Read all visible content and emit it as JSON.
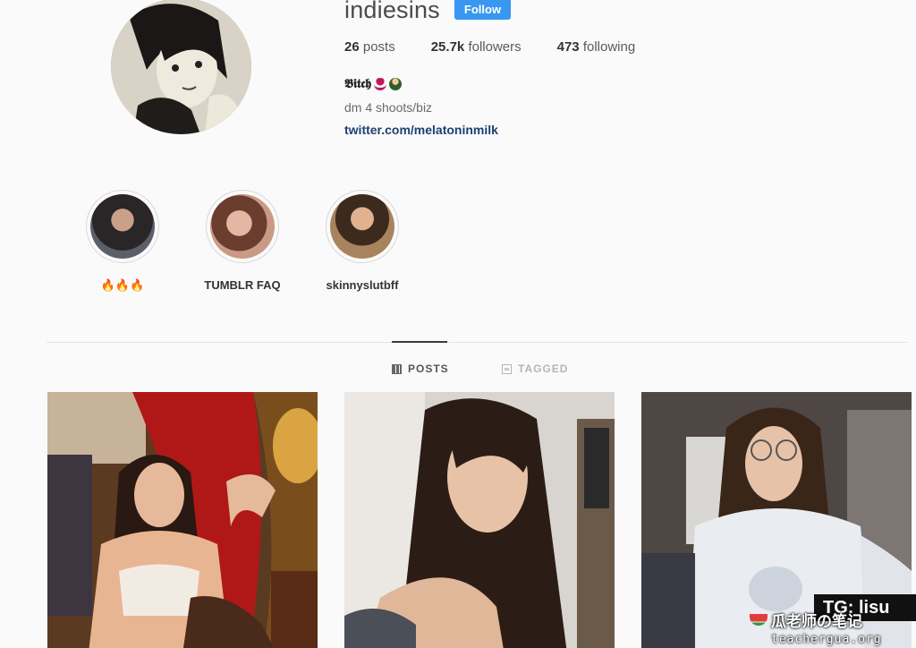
{
  "profile": {
    "username": "indiesins",
    "follow_label": "Follow",
    "stats": {
      "posts_count": "26",
      "posts_label": "posts",
      "followers_count": "25.7k",
      "followers_label": "followers",
      "following_count": "473",
      "following_label": "following"
    },
    "bio_name": "𝕭𝖎𝖙𝖈𝖍",
    "bio_emojis": [
      "wine-glass-emoji",
      "woman-emoji"
    ],
    "bio_line": "dm 4 shoots/biz",
    "bio_link": "twitter.com/melatoninmilk"
  },
  "highlights": [
    {
      "label": "🔥🔥🔥",
      "color": "#2e2a2c"
    },
    {
      "label": "TUMBLR FAQ",
      "color": "#b88a78"
    },
    {
      "label": "skinnyslutbff",
      "color": "#8a6a4e"
    }
  ],
  "tabs": [
    {
      "label": "POSTS",
      "icon": "grid-icon",
      "active": true
    },
    {
      "label": "TAGGED",
      "icon": "tag-icon",
      "active": false
    }
  ],
  "posts": [
    {
      "subject": "portrait-red-curtain",
      "dominant_color": "#a91c1c"
    },
    {
      "subject": "selfie-long-hair",
      "dominant_color": "#c9c2b8"
    },
    {
      "subject": "selfie-glasses",
      "dominant_color": "#5e5652"
    }
  ],
  "overlay": {
    "watermark_title": "瓜老师の笔记",
    "watermark_url": "teachergua.org",
    "badge_text": "TG: lisu"
  },
  "colors": {
    "accent": "#3897f0",
    "link": "#1f3f74",
    "background": "#fafafa"
  }
}
